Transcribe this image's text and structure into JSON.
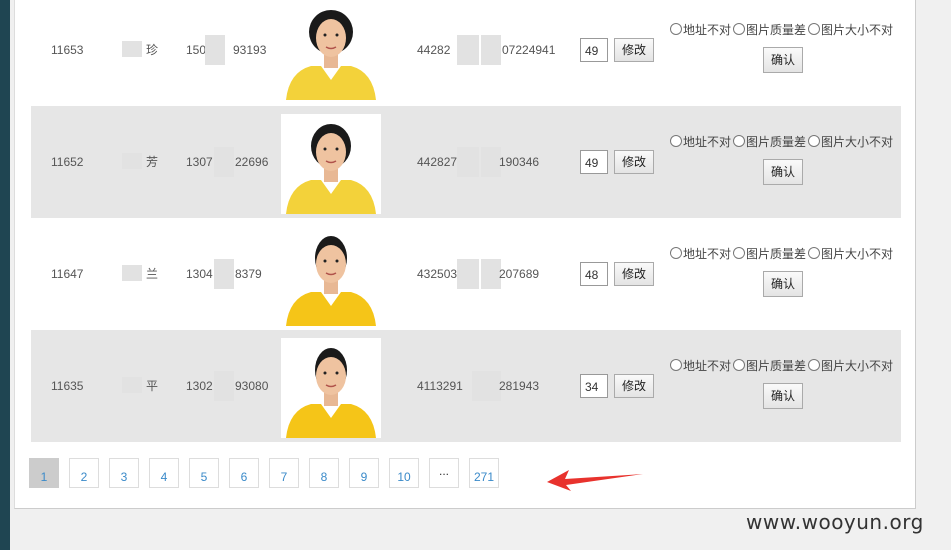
{
  "rows": [
    {
      "id": "11653",
      "name": "珍",
      "phone_a": "150",
      "phone_b": "93193",
      "idcard_a": "44282",
      "idcard_b": "07224941",
      "score": "49"
    },
    {
      "id": "11652",
      "name": "芳",
      "phone_a": "1307",
      "phone_b": "22696",
      "idcard_a": "442827",
      "idcard_b": "190346",
      "score": "49"
    },
    {
      "id": "11647",
      "name": "兰",
      "phone_a": "1304",
      "phone_b": "8379",
      "idcard_a": "432503",
      "idcard_b": "207689",
      "score": "48"
    },
    {
      "id": "11635",
      "name": "平",
      "phone_a": "1302",
      "phone_b": "93080",
      "idcard_a": "4113291",
      "idcard_b": "281943",
      "score": "34"
    }
  ],
  "labels": {
    "modify": "修改",
    "confirm": "确认",
    "reason_address": "地址不对",
    "reason_quality": "图片质量差",
    "reason_size": "图片大小不对"
  },
  "pagination": {
    "pages": [
      "1",
      "2",
      "3",
      "4",
      "5",
      "6",
      "7",
      "8",
      "9",
      "10",
      "...",
      "271"
    ],
    "current": "1"
  },
  "watermark": "www.wooyun.org",
  "colors": {
    "sidebar": "#1f4552",
    "row_shade": "#e6e6e6",
    "link": "#3a8ac9",
    "arrow": "#e8322d",
    "shirt": "#f5c518"
  }
}
